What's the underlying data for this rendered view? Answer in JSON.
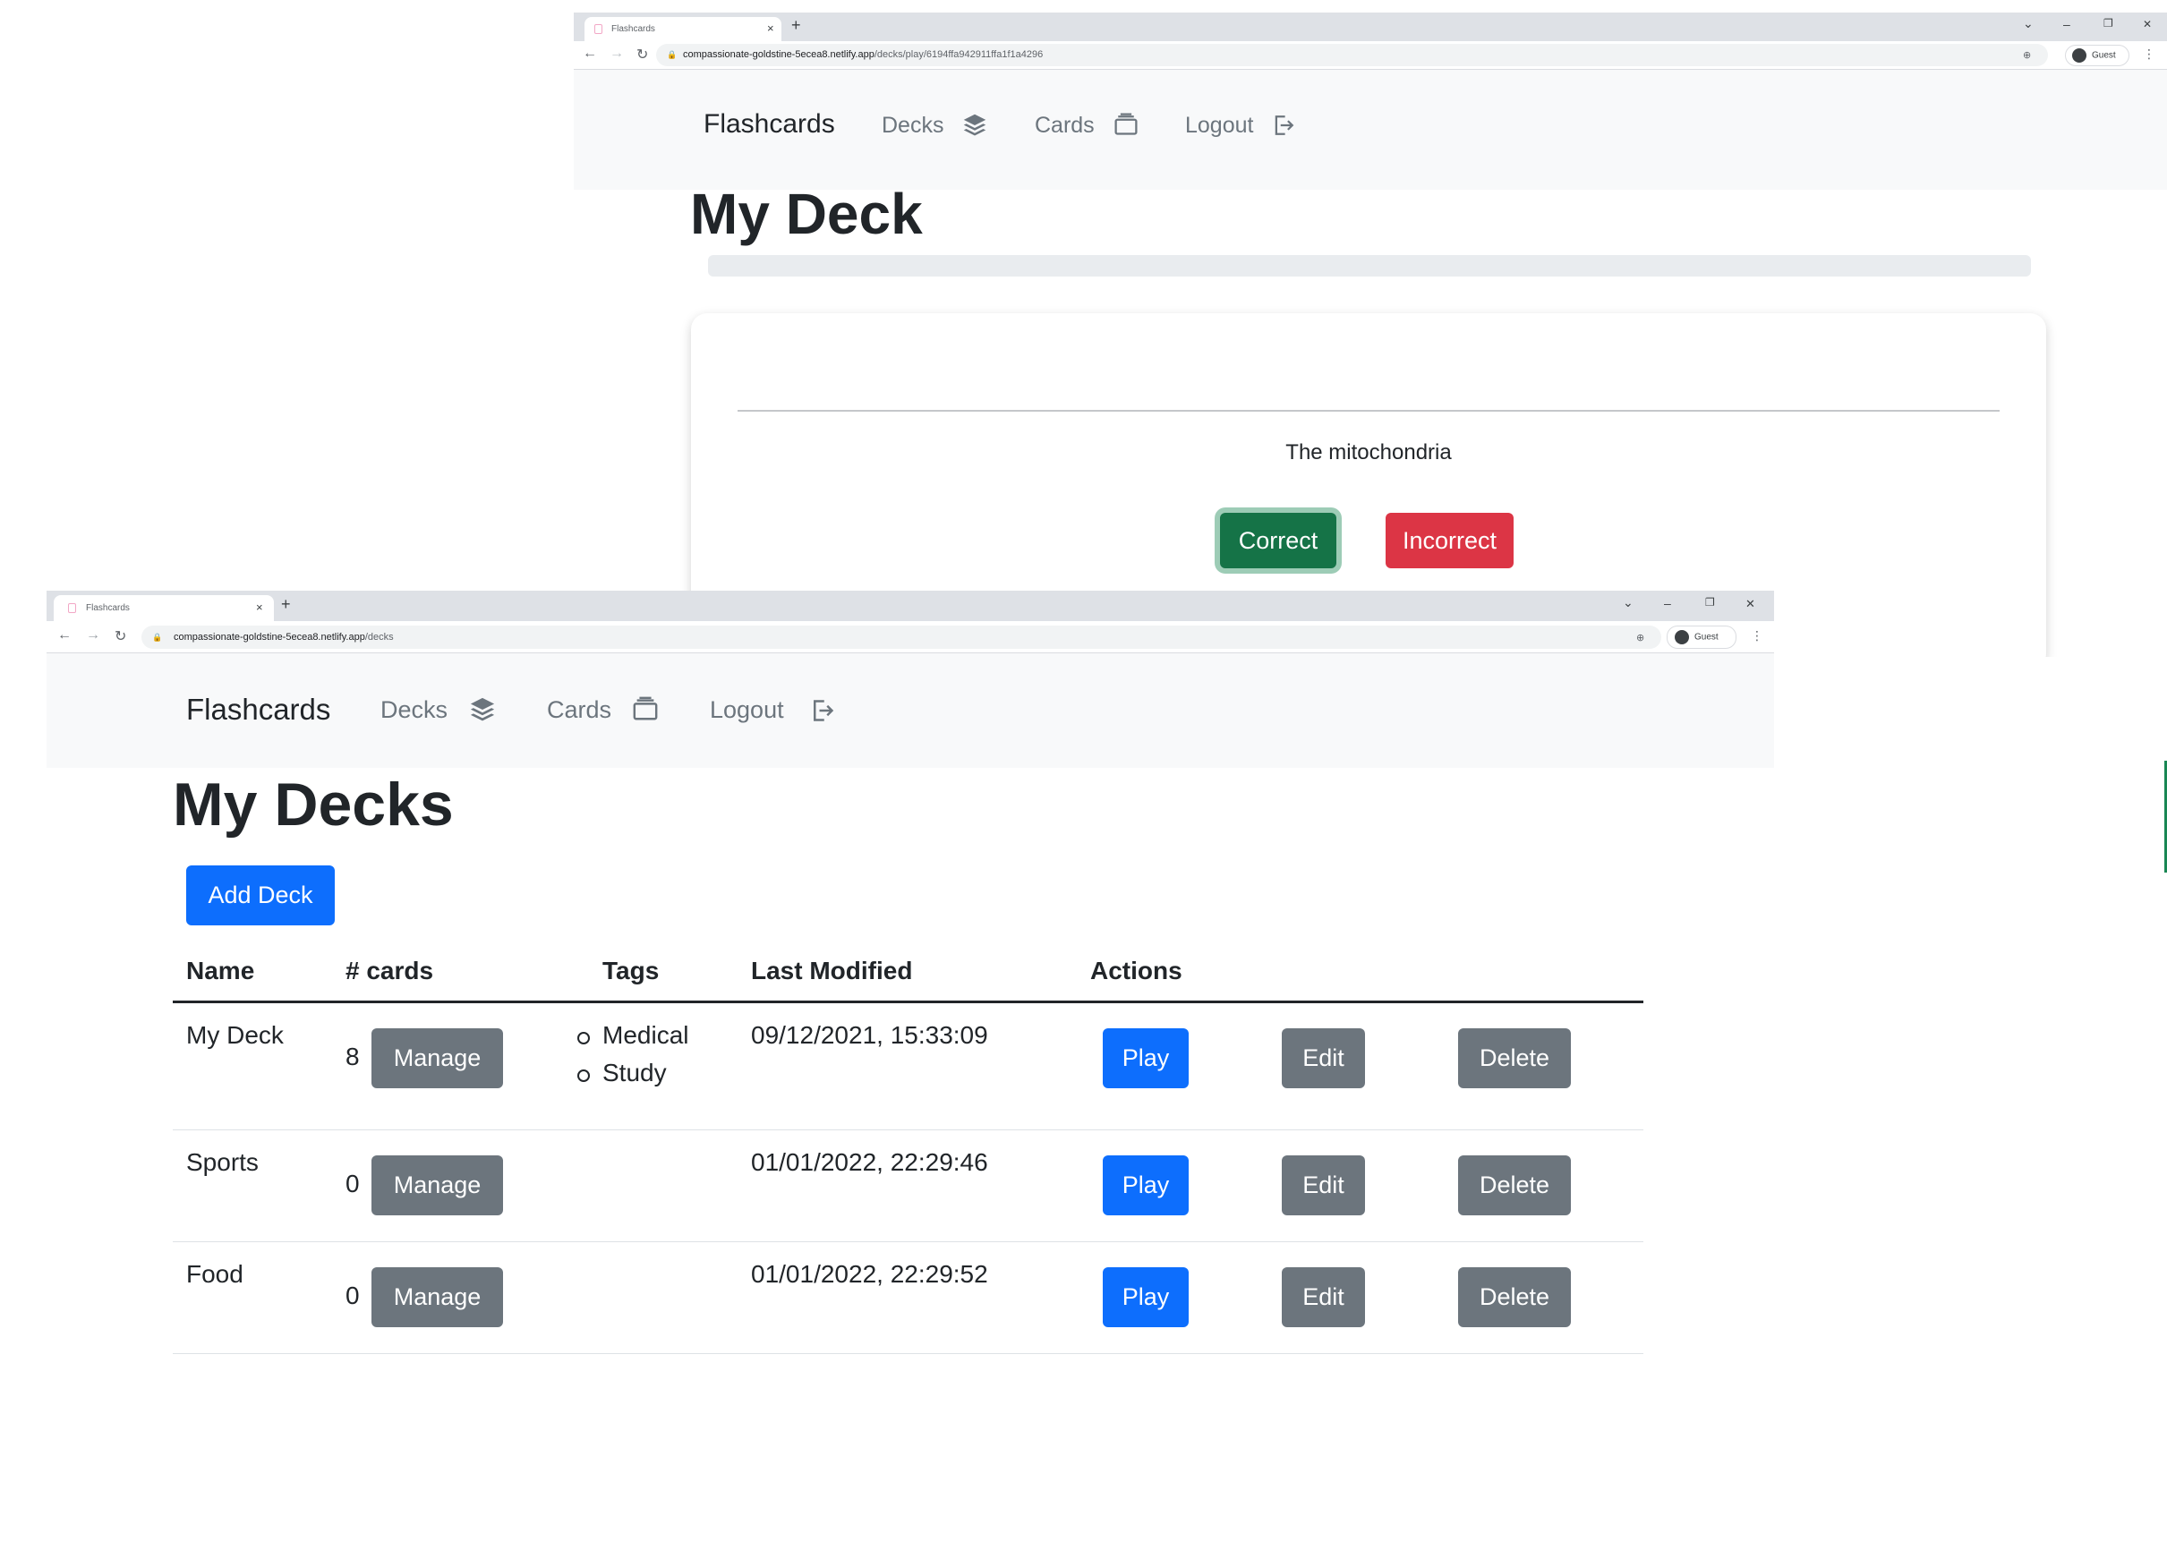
{
  "browser_tab_title": "Flashcards",
  "new_tab_label": "+",
  "window_controls": {
    "dropdown": "⌄",
    "minimize": "–",
    "restore": "❐",
    "close": "✕"
  },
  "guest_label": "Guest",
  "play_window": {
    "url_host": "compassionate-goldstine-5ecea8.netlify.app",
    "url_path": "/decks/play/6194ffa942911ffa1f1a4296",
    "title": "My Deck",
    "progress": 0,
    "card_front_text": "",
    "card_answer": "The mitochondria",
    "correct_label": "Correct",
    "incorrect_label": "Incorrect"
  },
  "decks_window": {
    "url_host": "compassionate-goldstine-5ecea8.netlify.app",
    "url_path": "/decks",
    "title": "My Decks",
    "add_deck_label": "Add Deck",
    "columns": [
      "Name",
      "# cards",
      "Tags",
      "Last Modified",
      "Actions"
    ],
    "rows": [
      {
        "name": "My Deck",
        "cards": "8",
        "tags": [
          "Medical",
          "Study"
        ],
        "modified": "09/12/2021, 15:33:09"
      },
      {
        "name": "Sports",
        "cards": "0",
        "tags": [],
        "modified": "01/01/2022, 22:29:46"
      },
      {
        "name": "Food",
        "cards": "0",
        "tags": [],
        "modified": "01/01/2022, 22:29:52"
      }
    ],
    "actions": {
      "manage": "Manage",
      "play": "Play",
      "edit": "Edit",
      "delete": "Delete"
    }
  },
  "navbar": {
    "brand": "Flashcards",
    "decks": "Decks",
    "cards": "Cards",
    "logout": "Logout"
  },
  "icons": {
    "decks": "layers-icon",
    "cards": "card-stack-icon",
    "logout": "logout-icon"
  },
  "colors": {
    "primary": "#0d6efd",
    "secondary": "#6c757d",
    "success": "#157347",
    "danger": "#dc3545",
    "navbar_bg": "#f8f9fa"
  }
}
